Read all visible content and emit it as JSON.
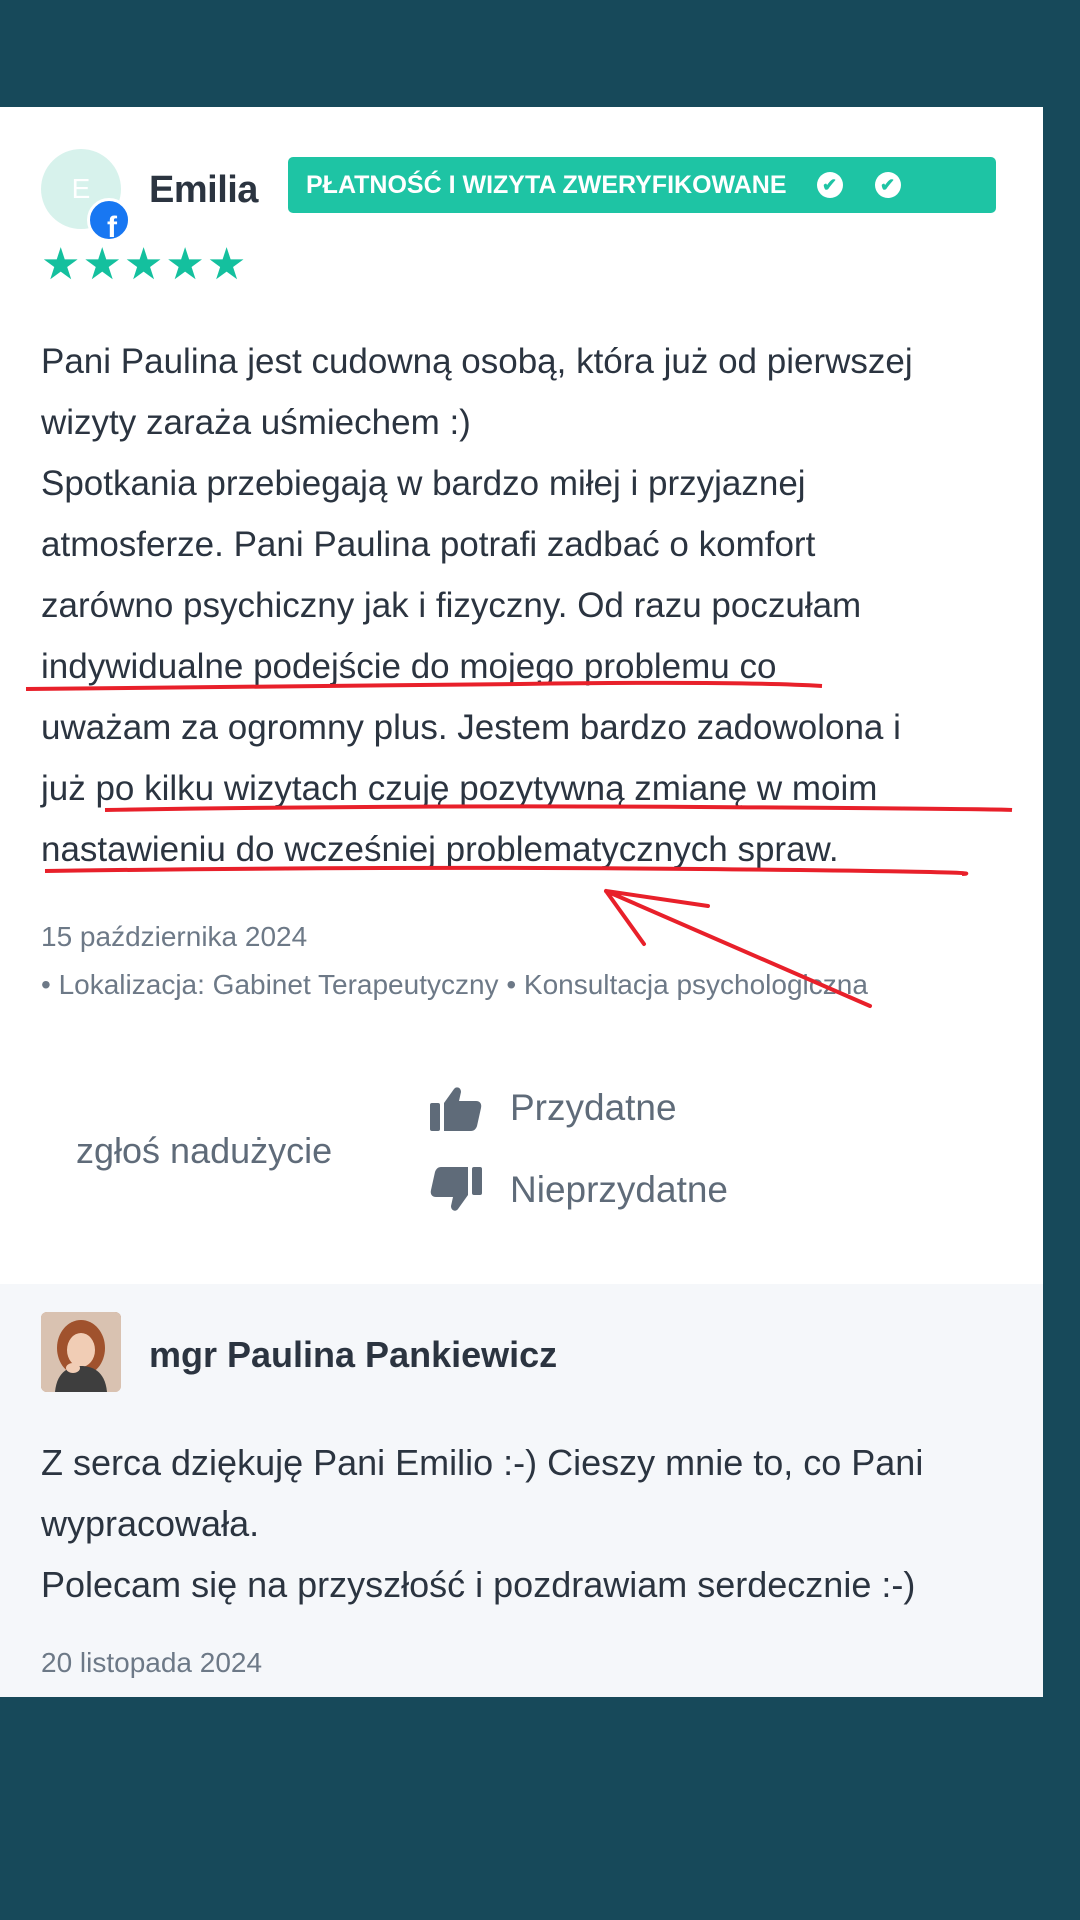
{
  "review": {
    "avatar_initial": "E",
    "author": "Emilia",
    "badge": "PŁATNOŚĆ I WIZYTA ZWERYFIKOWANE",
    "rating": 5,
    "body_lines": [
      "Pani Paulina jest cudowną osobą, która już od pierwszej",
      "wizyty zaraża uśmiechem :)",
      "Spotkania przebiegają w bardzo miłej i przyjaznej",
      "atmosferze. Pani Paulina potrafi zadbać o komfort",
      "zarówno psychiczny jak i fizyczny. Od razu poczułam",
      "indywidualne podejście do mojego problemu co",
      "uważam za ogromny plus. Jestem bardzo zadowolona i",
      "już po kilku wizytach czuję pozytywną zmianę w moim",
      "nastawieniu do wcześniej problematycznych spraw."
    ],
    "date": "15 października 2024",
    "meta": "• Lokalizacja: Gabinet Terapeutyczny • Konsultacja psychologiczna",
    "report_label": "zgłoś nadużycie",
    "helpful_label": "Przydatne",
    "unhelpful_label": "Nieprzydatne"
  },
  "reply": {
    "author": "mgr Paulina Pankiewicz",
    "lines": [
      "Z serca dziękuję Pani Emilio :-) Cieszy mnie to, co Pani",
      "wypracowała.",
      "Polecam się na przyszłość i pozdrawiam serdecznie :-)"
    ],
    "date": "20 listopada 2024"
  },
  "colors": {
    "background": "#17495a",
    "badge": "#1ec4a4",
    "stars": "#14c09e",
    "annotation": "#e8202a"
  },
  "icons": [
    "facebook-icon",
    "check-icon",
    "star-icon",
    "thumbs-up-icon",
    "thumbs-down-icon"
  ]
}
